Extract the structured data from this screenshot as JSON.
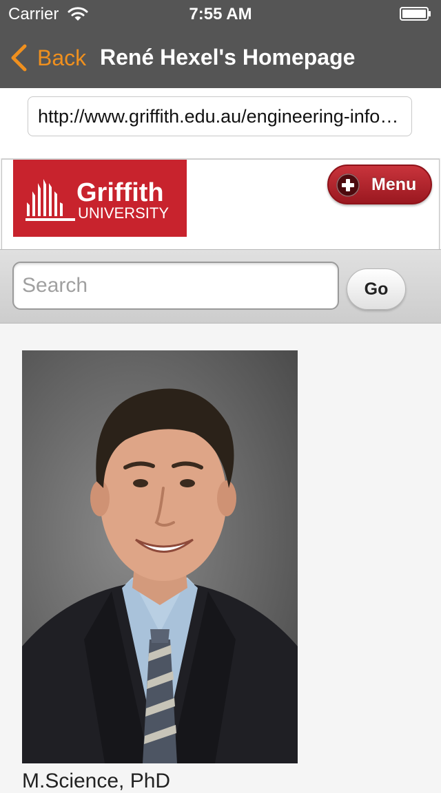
{
  "status_bar": {
    "carrier": "Carrier",
    "time": "7:55 AM",
    "wifi_icon": "wifi-icon",
    "battery_icon": "battery-icon"
  },
  "nav": {
    "back_label": "Back",
    "title": "René Hexel's Homepage",
    "accent_color": "#f0901e"
  },
  "url_bar": {
    "value": "http://www.griffith.edu.au/engineering-information-technology/school-information-communication-technology/staff/rene-hexel"
  },
  "site_header": {
    "logo": {
      "brand_name": "Griffith",
      "brand_sub": "UNIVERSITY",
      "brand_color": "#c8232d"
    },
    "menu_button": {
      "label": "Menu",
      "icon": "plus-icon"
    }
  },
  "search": {
    "placeholder": "Search",
    "value": "",
    "go_label": "Go"
  },
  "profile": {
    "photo_icon": "portrait-photo",
    "degrees": "M.Science, PhD"
  }
}
